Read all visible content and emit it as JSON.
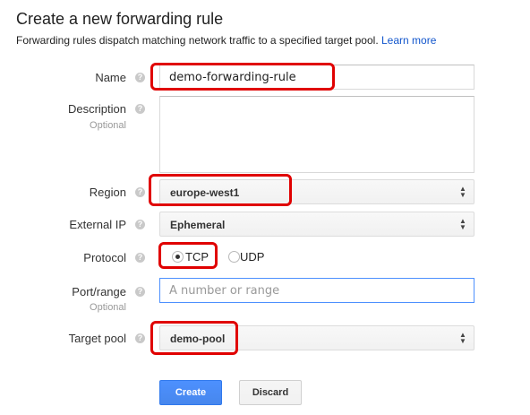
{
  "header": {
    "title": "Create a new forwarding rule",
    "subtitle": "Forwarding rules dispatch matching network traffic to a specified target pool.",
    "learn_more": "Learn more"
  },
  "form": {
    "name": {
      "label": "Name",
      "value": "demo-forwarding-rule"
    },
    "description": {
      "label": "Description",
      "optional": "Optional",
      "value": ""
    },
    "region": {
      "label": "Region",
      "value": "europe-west1"
    },
    "external_ip": {
      "label": "External IP",
      "value": "Ephemeral"
    },
    "protocol": {
      "label": "Protocol",
      "options": [
        "TCP",
        "UDP"
      ],
      "selected": "TCP"
    },
    "port_range": {
      "label": "Port/range",
      "optional": "Optional",
      "placeholder": "A number or range"
    },
    "target_pool": {
      "label": "Target pool",
      "value": "demo-pool"
    }
  },
  "buttons": {
    "create": "Create",
    "discard": "Discard"
  },
  "help_glyph": "?",
  "select_arrow_up": "▲",
  "select_arrow_down": "▼",
  "colors": {
    "highlight": "#e00000",
    "primary": "#4d90fe",
    "link": "#1155cc"
  }
}
